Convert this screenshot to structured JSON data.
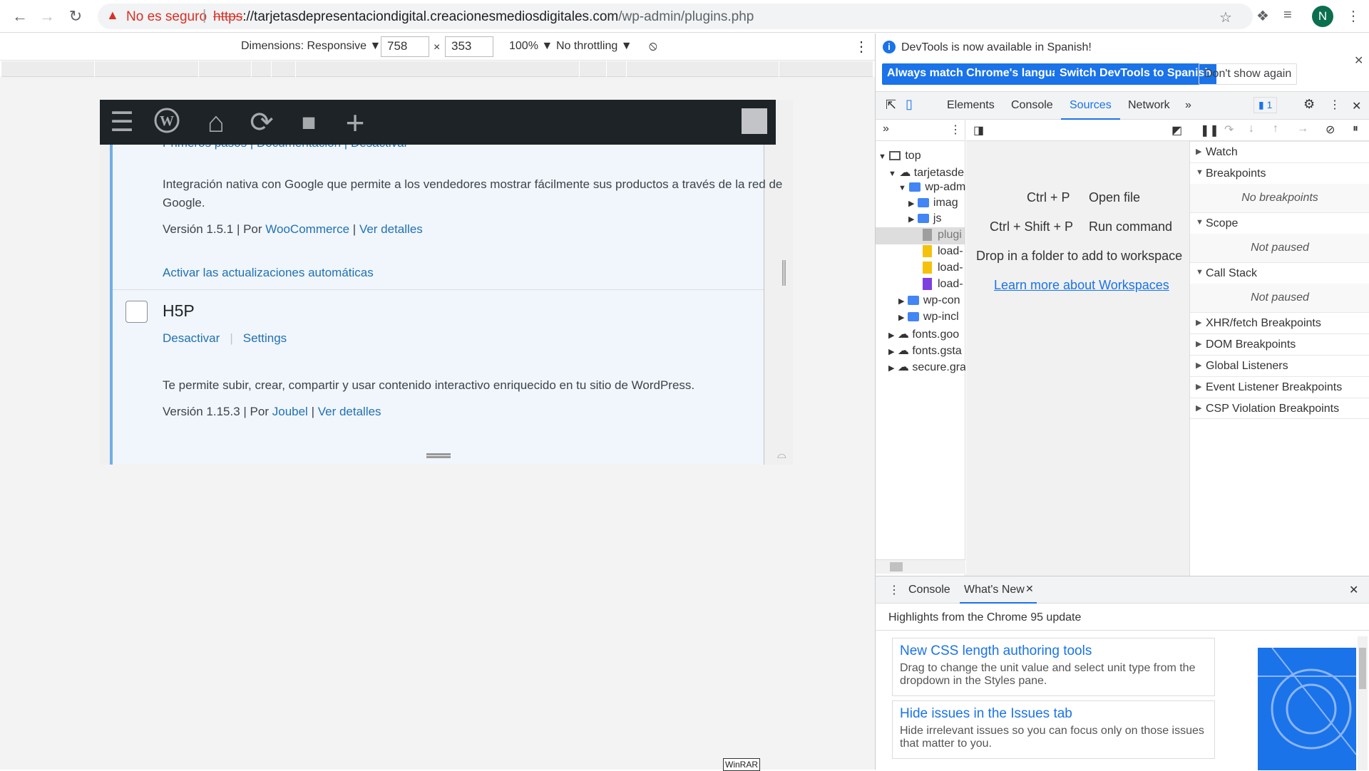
{
  "browser": {
    "security_label": "No es seguro",
    "url_scheme": "https",
    "url_host": "://tarjetasdepresentaciondigital.creacionesmediosdigitales.com",
    "url_path": "/wp-admin/plugins.php",
    "avatar_letter": "N"
  },
  "device_toolbar": {
    "dimensions_label": "Dimensions: Responsive ▼",
    "width": "758",
    "times": "×",
    "height": "353",
    "zoom": "100% ▼",
    "throttling": "No throttling ▼"
  },
  "wp": {
    "partial_links": "Primeros pasos   |   Documentación   |   Desactivar",
    "plugin1_description_l1": "Integración nativa con Google que permite a los vendedores mostrar fácilmente sus productos a través de la red de",
    "plugin1_description_l2": "Google.",
    "plugin1_version": "Versión 1.5.1 | Por ",
    "plugin1_author": "WooCommerce",
    "plugin1_sep": " | ",
    "plugin1_details": "Ver detalles",
    "plugin1_autoupdate": "Activar las actualizaciones automáticas",
    "plugin2_name": "H5P",
    "plugin2_deactivate": "Desactivar",
    "plugin2_pipe": "|",
    "plugin2_settings": "Settings",
    "plugin2_description": "Te permite subir, crear, compartir y usar contenido interactivo enriquecido en tu sitio de WordPress.",
    "plugin2_version": "Versión 1.15.3 | Por ",
    "plugin2_author": "Joubel",
    "plugin2_sep": " | ",
    "plugin2_details": "Ver detalles"
  },
  "devtools": {
    "infobar_text": "DevTools is now available in Spanish!",
    "btn_match": "Always match Chrome's language",
    "btn_switch": "Switch DevTools to Spanish",
    "btn_dont": "Don't show again",
    "tabs": [
      "Elements",
      "Console",
      "Sources",
      "Network"
    ],
    "issues_count": "1",
    "tree": {
      "top": "top",
      "domain": "tarjetasde",
      "wp_admin": "wp-adm",
      "images": "imag",
      "js": "js",
      "plugins": "plugi",
      "load1": "load-",
      "load2": "load-",
      "load3": "load-",
      "wp_content": "wp-con",
      "wp_includes": "wp-incl",
      "fonts_goo": "fonts.goo",
      "fonts_gsta": "fonts.gsta",
      "secure": "secure.gra"
    },
    "editor": {
      "open_key": "Ctrl + P",
      "open_label": "Open file",
      "run_key": "Ctrl + Shift + P",
      "run_label": "Run command",
      "drop": "Drop in a folder to add to workspace",
      "learn": "Learn more about Workspaces"
    },
    "debugger": {
      "watch": "Watch",
      "breakpoints": "Breakpoints",
      "no_breakpoints": "No breakpoints",
      "scope": "Scope",
      "not_paused_1": "Not paused",
      "call_stack": "Call Stack",
      "not_paused_2": "Not paused",
      "xhr": "XHR/fetch Breakpoints",
      "dom": "DOM Breakpoints",
      "global": "Global Listeners",
      "event": "Event Listener Breakpoints",
      "csp": "CSP Violation Breakpoints"
    },
    "drawer": {
      "tab_console": "Console",
      "tab_whatsnew": "What's New",
      "highlights": "Highlights from the Chrome 95 update",
      "card1_title": "New CSS length authoring tools",
      "card1_body": "Drag to change the unit value and select unit type from the dropdown in the Styles pane.",
      "card2_title": "Hide issues in the Issues tab",
      "card2_body": "Hide irrelevant issues so you can focus only on those issues that matter to you."
    }
  },
  "taskbar_hint": "WinRAR"
}
